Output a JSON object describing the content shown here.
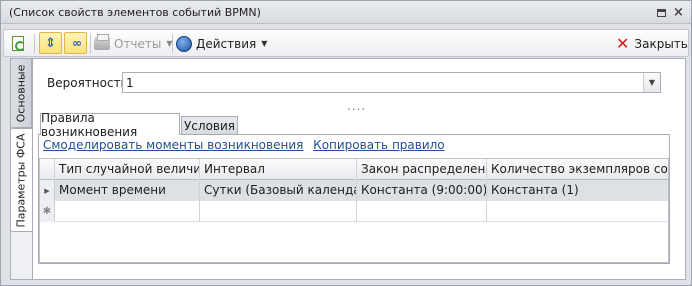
{
  "window": {
    "title": "(Список свойств элементов событий BPMN)"
  },
  "toolbar": {
    "reports_label": "Отчеты",
    "actions_label": "Действия",
    "close_label": "Закрыть"
  },
  "side_tabs": {
    "main": "Основные",
    "params": "Параметры ФСА"
  },
  "probability": {
    "label": "Вероятность:",
    "value": "1"
  },
  "tabs": {
    "rules": "Правила возникновения",
    "conditions": "Условия"
  },
  "links": {
    "model": "Смоделировать моменты возникновения",
    "copy": "Копировать правило"
  },
  "grid": {
    "columns": [
      "Тип случайной величины",
      "Интервал",
      "Закон распределения",
      "Количество экземпляров события"
    ],
    "rows": [
      [
        "Момент времени",
        "Сутки (Базовый календарь)",
        "Константа (9:00:00)",
        "Константа (1)"
      ]
    ],
    "new_row": [
      "",
      "",
      "",
      ""
    ]
  },
  "icons": {
    "title_restore": "restore-icon",
    "title_close": "close-icon",
    "doc": "document-refresh-icon",
    "expand": "expand-icon",
    "link": "link-icon",
    "printer": "printer-icon",
    "globe": "globe-icon",
    "close": "close-red-icon",
    "dropdown": "chevron-down-icon",
    "row_current": "row-pointer-icon",
    "row_new": "new-row-icon"
  }
}
